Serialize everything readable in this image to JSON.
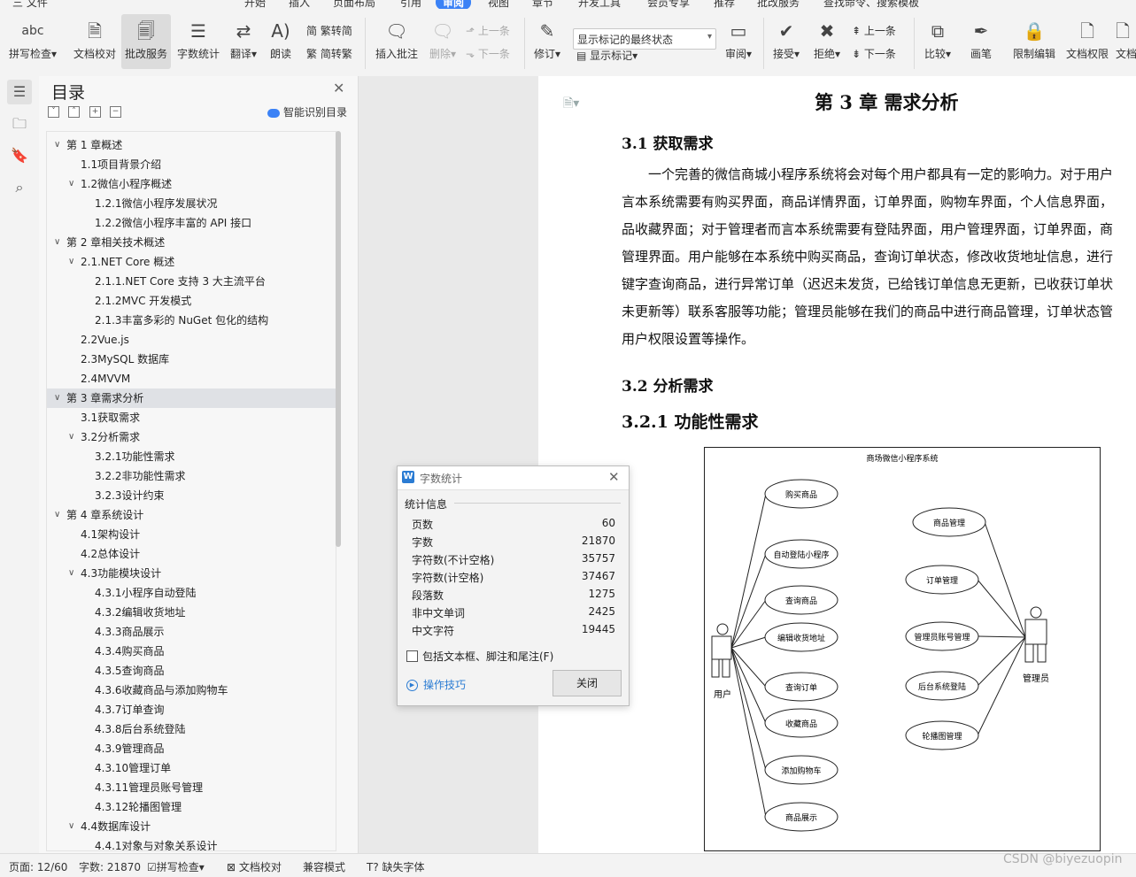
{
  "menubar": {
    "items": [
      "三 文件",
      "开始",
      "插入",
      "页面布局",
      "引用",
      "审阅",
      "视图",
      "章节",
      "开发工具",
      "会员专享",
      "推荐",
      "批改服务",
      "查找命令、搜索模板"
    ],
    "active_index": 5
  },
  "ribbon": {
    "buttons": [
      {
        "label": "拼写检查",
        "icon": "abc",
        "dropdown": true
      },
      {
        "label": "文档校对",
        "icon": "doc-check-icon",
        "dropdown": false
      },
      {
        "label": "批改服务",
        "icon": "doc-search-icon",
        "dropdown": false,
        "selected": true
      },
      {
        "label": "字数统计",
        "icon": "word-count-icon",
        "dropdown": false
      },
      {
        "label": "翻译",
        "icon": "translate-icon",
        "dropdown": true
      },
      {
        "label": "朗读",
        "icon": "read-aloud-icon",
        "dropdown": false
      }
    ],
    "convert": {
      "trad": "繁转简",
      "simp": "简转繁"
    },
    "insert_comment": "插入批注",
    "delete": "删除",
    "prev": "上一条",
    "next": "下一条",
    "revise": "修订",
    "markup_select": "显示标记的最终状态",
    "show_markup": "显示标记",
    "review": "审阅",
    "accept": "接受",
    "reject": "拒绝",
    "prev2": "上一条",
    "next2": "下一条",
    "compare": "比较",
    "pen": "画笔",
    "restrict": "限制编辑",
    "perm": "文档权限",
    "more": "文档"
  },
  "toc": {
    "title": "目录",
    "smart_label": "智能识别目录",
    "items": [
      {
        "text": "第 1 章概述",
        "level": 1,
        "expanded": true
      },
      {
        "text": "1.1项目背景介绍",
        "level": 2
      },
      {
        "text": "1.2微信小程序概述",
        "level": 2,
        "expanded": true
      },
      {
        "text": "1.2.1微信小程序发展状况",
        "level": 3
      },
      {
        "text": "1.2.2微信小程序丰富的 API 接口",
        "level": 3
      },
      {
        "text": "第 2 章相关技术概述",
        "level": 1,
        "expanded": true
      },
      {
        "text": "2.1.NET Core 概述",
        "level": 2,
        "expanded": true
      },
      {
        "text": "2.1.1.NET Core 支持 3 大主流平台",
        "level": 3
      },
      {
        "text": "2.1.2MVC 开发模式",
        "level": 3
      },
      {
        "text": "2.1.3丰富多彩的 NuGet 包化的结构",
        "level": 3
      },
      {
        "text": "2.2Vue.js",
        "level": 2
      },
      {
        "text": "2.3MySQL 数据库",
        "level": 2
      },
      {
        "text": "2.4MVVM",
        "level": 2
      },
      {
        "text": "第 3 章需求分析",
        "level": 1,
        "expanded": true,
        "selected": true
      },
      {
        "text": "3.1获取需求",
        "level": 2
      },
      {
        "text": "3.2分析需求",
        "level": 2,
        "expanded": true
      },
      {
        "text": "3.2.1功能性需求",
        "level": 3
      },
      {
        "text": "3.2.2非功能性需求",
        "level": 3
      },
      {
        "text": "3.2.3设计约束",
        "level": 3
      },
      {
        "text": "第 4 章系统设计",
        "level": 1,
        "expanded": true
      },
      {
        "text": "4.1架构设计",
        "level": 2
      },
      {
        "text": "4.2总体设计",
        "level": 2
      },
      {
        "text": "4.3功能模块设计",
        "level": 2,
        "expanded": true
      },
      {
        "text": "4.3.1小程序自动登陆",
        "level": 3
      },
      {
        "text": "4.3.2编辑收货地址",
        "level": 3
      },
      {
        "text": "4.3.3商品展示",
        "level": 3
      },
      {
        "text": "4.3.4购买商品",
        "level": 3
      },
      {
        "text": "4.3.5查询商品",
        "level": 3
      },
      {
        "text": "4.3.6收藏商品与添加购物车",
        "level": 3
      },
      {
        "text": "4.3.7订单查询",
        "level": 3
      },
      {
        "text": "4.3.8后台系统登陆",
        "level": 3
      },
      {
        "text": "4.3.9管理商品",
        "level": 3
      },
      {
        "text": "4.3.10管理订单",
        "level": 3
      },
      {
        "text": "4.3.11管理员账号管理",
        "level": 3
      },
      {
        "text": "4.3.12轮播图管理",
        "level": 3
      },
      {
        "text": "4.4数据库设计",
        "level": 2,
        "expanded": true
      },
      {
        "text": "4.4.1对象与对象关系设计",
        "level": 3
      }
    ]
  },
  "document": {
    "chapter": "第 3 章  需求分析",
    "h_3_1": "3.1  获取需求",
    "paragraph_lines": [
      "　　一个完善的微信商城小程序系统将会对每个用户都具有一定的影响力。对于用户",
      "言本系统需要有购买界面，商品详情界面，订单界面，购物车界面，个人信息界面，",
      "品收藏界面；对于管理者而言本系统需要有登陆界面，用户管理界面，订单界面，商",
      "管理界面。用户能够在本系统中购买商品，查询订单状态，修改收货地址信息，进行",
      "键字查询商品，进行异常订单（迟迟未发货，已给钱订单信息无更新，已收获订单状",
      "未更新等）联系客服等功能；管理员能够在我们的商品中进行商品管理，订单状态管",
      "用户权限设置等操作。"
    ],
    "h_3_2": "3.2  分析需求",
    "h_3_2_1": "3.2.1  功能性需求"
  },
  "diagram": {
    "title": "商场微信小程序系统",
    "actor_user": "用户",
    "actor_admin": "管理员",
    "user_cases": [
      "购买商品",
      "自动登陆小程序",
      "查询商品",
      "编辑收货地址",
      "查询订单",
      "收藏商品",
      "添加购物车",
      "商品展示"
    ],
    "admin_cases": [
      "商品管理",
      "订单管理",
      "管理员账号管理",
      "后台系统登陆",
      "轮播图管理"
    ]
  },
  "dialog": {
    "title": "字数统计",
    "section": "统计信息",
    "stats": [
      {
        "label": "页数",
        "value": "60"
      },
      {
        "label": "字数",
        "value": "21870"
      },
      {
        "label": "字符数(不计空格)",
        "value": "35757"
      },
      {
        "label": "字符数(计空格)",
        "value": "37467"
      },
      {
        "label": "段落数",
        "value": "1275"
      },
      {
        "label": "非中文单词",
        "value": "2425"
      },
      {
        "label": "中文字符",
        "value": "19445"
      }
    ],
    "checkbox_label": "包括文本框、脚注和尾注(F)",
    "tips_link": "操作技巧",
    "close_button": "关闭"
  },
  "status": {
    "page": "页面: 12/60",
    "words": "字数: 21870",
    "spell": "拼写检查",
    "proof": "文档校对",
    "compat": "兼容模式",
    "missing_font": "缺失字体"
  },
  "watermark": "CSDN @biyezuopin",
  "colors": {
    "accent": "#3b82f6",
    "link": "#2b7cd3",
    "selected_row": "#dfe1e5"
  }
}
